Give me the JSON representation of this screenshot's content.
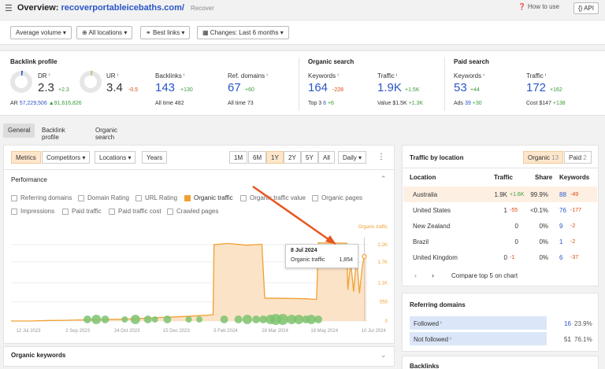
{
  "header": {
    "title_prefix": "Overview:",
    "domain": "recoverportableicebaths.com/",
    "subtitle": "Recover",
    "how_to_use": "How to use",
    "api": "{} API"
  },
  "filters": {
    "volume": "Average volume ▾",
    "locations": "All locations ▾",
    "links": "Best links ▾",
    "changes": "Changes: Last 6 months ▾"
  },
  "backlink_profile": {
    "title": "Backlink profile",
    "dr_label": "DR ⁱ",
    "dr_value": "2.3",
    "dr_delta": "+2.3",
    "ur_label": "UR ⁱ",
    "ur_value": "3.4",
    "ur_delta": "-0.5",
    "ar_label": "AR",
    "ar_value": "57,229,506",
    "ar_delta": "▲91,616,826",
    "backlinks_label": "Backlinks ⁱ",
    "backlinks_value": "143",
    "backlinks_delta": "+130",
    "backlinks_all_label": "All time",
    "backlinks_all": "482",
    "refdomains_label": "Ref. domains ⁱ",
    "refdomains_value": "67",
    "refdomains_delta": "+60",
    "refdomains_all_label": "All time",
    "refdomains_all": "73"
  },
  "organic_search": {
    "title": "Organic search",
    "keywords_label": "Keywords ⁱ",
    "keywords_value": "164",
    "keywords_delta": "-228",
    "top3_label": "Top 3",
    "top3_value": "6",
    "top3_delta": "+6",
    "traffic_label": "Traffic ⁱ",
    "traffic_value": "1.9K",
    "traffic_delta": "+1.5K",
    "value_label": "Value",
    "value_value": "$1.5K",
    "value_delta": "+1.3K"
  },
  "paid_search": {
    "title": "Paid search",
    "keywords_label": "Keywords ⁱ",
    "keywords_value": "53",
    "keywords_delta": "+44",
    "ads_label": "Ads",
    "ads_value": "39",
    "ads_delta": "+30",
    "traffic_label": "Traffic ⁱ",
    "traffic_value": "172",
    "traffic_delta": "+162",
    "cost_label": "Cost",
    "cost_value": "$147",
    "cost_delta": "+138"
  },
  "tabs": {
    "general": "General",
    "backlink_profile": "Backlink profile",
    "organic_search": "Organic search"
  },
  "chart_toolbar": {
    "metrics": "Metrics",
    "competitors": "Competitors ▾",
    "locations": "Locations ▾",
    "years": "Years",
    "ranges": [
      "1M",
      "6M",
      "1Y",
      "2Y",
      "5Y",
      "All"
    ],
    "active_range": "1Y",
    "interval": "Daily ▾",
    "more": "⋮"
  },
  "performance": {
    "title": "Performance",
    "checkboxes_row1": [
      "Referring domains",
      "Domain Rating",
      "URL Rating",
      "Organic traffic",
      "Organic traffic value",
      "Organic pages"
    ],
    "checkboxes_row2": [
      "Impressions",
      "Paid traffic",
      "Paid traffic cost",
      "Crawled pages"
    ],
    "checked": "Organic traffic"
  },
  "chart_data": {
    "type": "area",
    "series": [
      {
        "name": "Organic traffic",
        "color": "#f0a030"
      }
    ],
    "x_ticks": [
      "12 Jul 2023",
      "2 Sep 2023",
      "24 Oct 2023",
      "15 Dec 2023",
      "5 Feb 2024",
      "28 Mar 2024",
      "19 May 2024",
      "10 Jul 2024"
    ],
    "y_ticks": [
      "0",
      "550",
      "1.1K",
      "1.7K",
      "2.2K"
    ],
    "y_axis_label": "Organic traffic",
    "ylim": [
      0,
      2400
    ],
    "points": [
      [
        "2023-07-12",
        0
      ],
      [
        "2023-08-01",
        0
      ],
      [
        "2023-08-20",
        15
      ],
      [
        "2023-09-05",
        20
      ],
      [
        "2023-09-25",
        35
      ],
      [
        "2023-10-15",
        40
      ],
      [
        "2023-11-01",
        50
      ],
      [
        "2023-11-20",
        70
      ],
      [
        "2023-12-10",
        100
      ],
      [
        "2024-01-05",
        130
      ],
      [
        "2024-01-25",
        160
      ],
      [
        "2024-02-04",
        180
      ],
      [
        "2024-02-05",
        2200
      ],
      [
        "2024-02-20",
        2230
      ],
      [
        "2024-03-10",
        2180
      ],
      [
        "2024-03-25",
        2210
      ],
      [
        "2024-03-28",
        660
      ],
      [
        "2024-05-10",
        640
      ],
      [
        "2024-05-20",
        620
      ],
      [
        "2024-05-22",
        2250
      ],
      [
        "2024-06-20",
        2240
      ],
      [
        "2024-06-21",
        900
      ],
      [
        "2024-06-24",
        1700
      ],
      [
        "2024-06-27",
        850
      ],
      [
        "2024-06-30",
        1854
      ],
      [
        "2024-07-03",
        800
      ],
      [
        "2024-07-06",
        1600
      ],
      [
        "2024-07-08",
        1854
      ],
      [
        "2024-07-10",
        1854
      ]
    ],
    "tooltip": {
      "date": "8 Jul 2024",
      "label": "Organic traffic",
      "value": "1,854"
    }
  },
  "organic_keywords": {
    "title": "Organic keywords"
  },
  "traffic_by_location": {
    "title": "Traffic by location",
    "organic_tab": "Organic",
    "organic_count": "13",
    "paid_tab": "Paid",
    "paid_count": "2",
    "headers": [
      "Location",
      "Traffic",
      "Share",
      "Keywords"
    ],
    "rows": [
      {
        "location": "Australia",
        "traffic": "1.9K",
        "tdelta": "+1.6K",
        "tdelta_type": "pos",
        "share": "99.9%",
        "keywords": "88",
        "kdelta": "-49"
      },
      {
        "location": "United States",
        "traffic": "1",
        "tdelta": "-55",
        "tdelta_type": "neg",
        "share": "<0.1%",
        "keywords": "76",
        "kdelta": "-177"
      },
      {
        "location": "New Zealand",
        "traffic": "0",
        "tdelta": "",
        "tdelta_type": "none",
        "share": "0%",
        "keywords": "9",
        "kdelta": "-2"
      },
      {
        "location": "Brazil",
        "traffic": "0",
        "tdelta": "",
        "tdelta_type": "none",
        "share": "0%",
        "keywords": "1",
        "kdelta": "-2"
      },
      {
        "location": "United Kingdom",
        "traffic": "0",
        "tdelta": "-1",
        "tdelta_type": "neg",
        "share": "0%",
        "keywords": "6",
        "kdelta": "-37"
      }
    ],
    "compare_label": "Compare top 5 on chart"
  },
  "referring_domains": {
    "title": "Referring domains",
    "rows": [
      {
        "label": "Followed ⁱ",
        "value": "16",
        "pct": "23.9%",
        "fill": 0.9
      },
      {
        "label": "Not followed ⁱ",
        "value": "51",
        "pct": "76.1%",
        "fill": 0.9
      }
    ]
  },
  "backlinks_section": {
    "title": "Backlinks"
  }
}
